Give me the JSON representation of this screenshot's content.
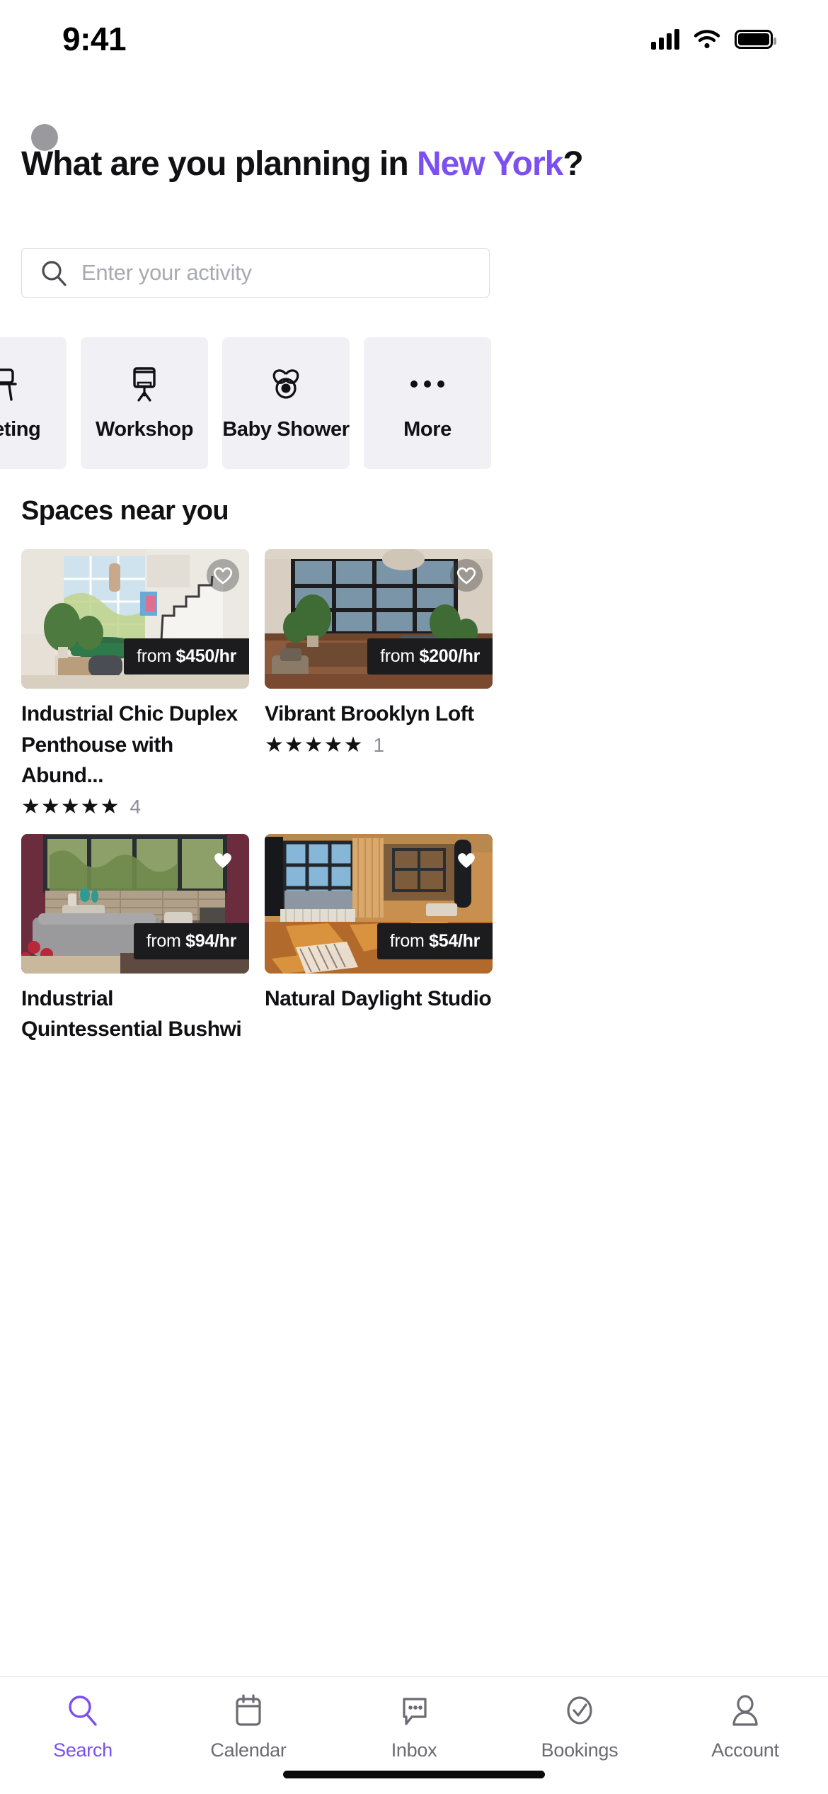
{
  "status_bar": {
    "time": "9:41",
    "signal_icon": "cellular-signal-icon",
    "wifi_icon": "wifi-icon",
    "battery_icon": "battery-icon"
  },
  "header": {
    "avatar_icon": "avatar",
    "title_prefix": "What are you planning in ",
    "city": "New York",
    "title_suffix": "?",
    "accent_color": "#7c4ff0"
  },
  "search": {
    "icon": "search-icon",
    "placeholder": "Enter your activity",
    "value": ""
  },
  "categories": [
    {
      "label": "Meeting",
      "icon": "podium-icon"
    },
    {
      "label": "Workshop",
      "icon": "easel-icon"
    },
    {
      "label": "Baby Shower",
      "icon": "pacifier-icon"
    },
    {
      "label": "More",
      "icon": "ellipsis-icon"
    }
  ],
  "spaces_section": {
    "title": "Spaces near you"
  },
  "listings": [
    {
      "title": "Industrial Chic Duplex Penthouse with Abund...",
      "price": "from $450/hr",
      "price_prefix": "from ",
      "price_value": "$450/hr",
      "stars": "★★★★★",
      "review_count": "4",
      "favorite_icon": "heart-outline-icon",
      "favorited": false
    },
    {
      "title": "Vibrant Brooklyn Loft",
      "price": "from $200/hr",
      "price_prefix": "from ",
      "price_value": "$200/hr",
      "stars": "★★★★★",
      "review_count": "1",
      "favorite_icon": "heart-outline-icon",
      "favorited": false
    },
    {
      "title": "Industrial Quintessential Bushwi",
      "price": "from $94/hr",
      "price_prefix": "from ",
      "price_value": "$94/hr",
      "stars": "",
      "review_count": "",
      "favorite_icon": "heart-filled-icon",
      "favorited": true
    },
    {
      "title": "Natural Daylight Studio",
      "price": "from $54/hr",
      "price_prefix": "from ",
      "price_value": "$54/hr",
      "stars": "",
      "review_count": "",
      "favorite_icon": "heart-filled-icon",
      "favorited": true
    }
  ],
  "tabbar": {
    "active": "Search",
    "items": [
      {
        "label": "Search",
        "icon": "search-icon"
      },
      {
        "label": "Calendar",
        "icon": "calendar-icon"
      },
      {
        "label": "Inbox",
        "icon": "chat-bubble-icon"
      },
      {
        "label": "Bookings",
        "icon": "check-circle-icon"
      },
      {
        "label": "Account",
        "icon": "person-icon"
      }
    ]
  }
}
